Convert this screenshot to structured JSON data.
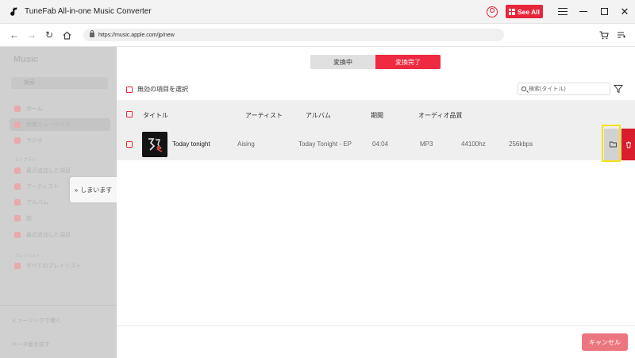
{
  "window": {
    "title": "TuneFab All-in-one Music Converter",
    "see_all_label": "See All"
  },
  "browser": {
    "url": "https://music.apple.com/jp/new"
  },
  "sidebar": {
    "logo": "Music",
    "search_placeholder": "検索",
    "items": [
      {
        "label": "ホーム"
      },
      {
        "label": "新着ミュージック"
      },
      {
        "label": "ラジオ"
      },
      {
        "label": "最近追加した項目"
      },
      {
        "label": "アーティスト"
      },
      {
        "label": "アルバム"
      },
      {
        "label": "曲"
      },
      {
        "label": "最近追加した項目"
      },
      {
        "label": "すべてのプレイリスト"
      }
    ],
    "sections": [
      "ライブラリ",
      "プレイリスト"
    ],
    "footer_items": [
      "ミュージックで聴く",
      "ベータ版を試す"
    ],
    "collapse_label": "しまいます"
  },
  "tabs": [
    {
      "label": "変換中",
      "active": false
    },
    {
      "label": "変換完了",
      "active": true
    }
  ],
  "toolbar": {
    "select_invalid_label": "無効の項目を選択",
    "search_placeholder": "検索(タイトル)"
  },
  "table": {
    "columns": [
      "タイトル",
      "アーティスト",
      "アルバム",
      "期間",
      "オーディオ品質"
    ],
    "rows": [
      {
        "title": "Today tonight",
        "artist": "Aising",
        "album": "Today Tonight - EP",
        "duration": "04:04",
        "format": "MP3",
        "sample_rate": "44100hz",
        "bitrate": "256kbps"
      }
    ]
  },
  "footer": {
    "cancel_label": "キャンセル"
  },
  "colors": {
    "accent": "#ee2940",
    "delete": "#d81d2c",
    "highlight": "#f4e11c",
    "cancel": "#ec7680"
  }
}
